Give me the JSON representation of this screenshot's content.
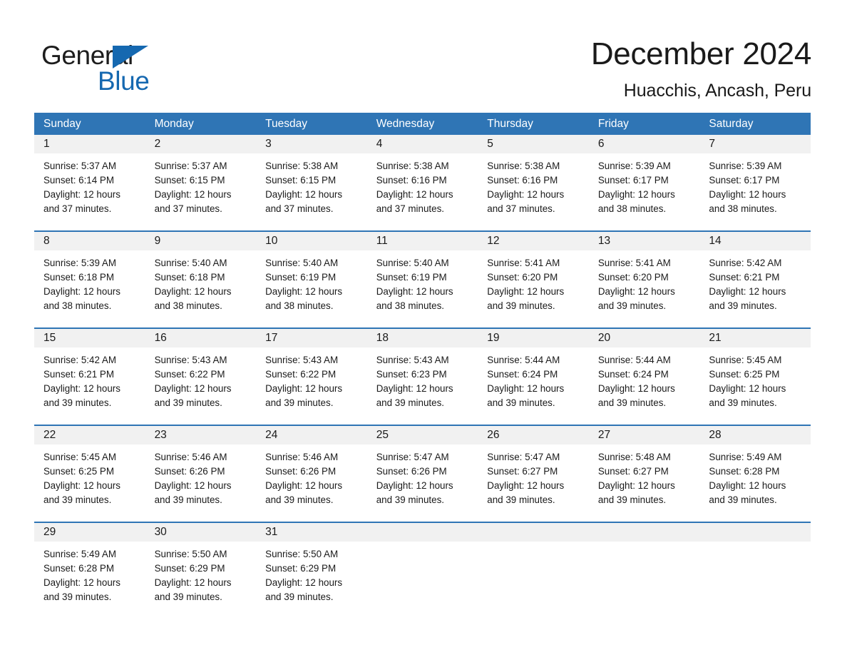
{
  "brand": {
    "word_general": "General",
    "word_blue": "Blue",
    "triangle_color": "#1568b0"
  },
  "header": {
    "month_title": "December 2024",
    "location": "Huacchis, Ancash, Peru"
  },
  "theme": {
    "header_blue": "#2f75b5",
    "daynum_band": "#f1f1f1",
    "text": "#1a1a1a"
  },
  "calendar": {
    "day_names": [
      "Sunday",
      "Monday",
      "Tuesday",
      "Wednesday",
      "Thursday",
      "Friday",
      "Saturday"
    ],
    "weeks": [
      [
        {
          "day": "1",
          "info": "Sunrise: 5:37 AM\nSunset: 6:14 PM\nDaylight: 12 hours and 37 minutes."
        },
        {
          "day": "2",
          "info": "Sunrise: 5:37 AM\nSunset: 6:15 PM\nDaylight: 12 hours and 37 minutes."
        },
        {
          "day": "3",
          "info": "Sunrise: 5:38 AM\nSunset: 6:15 PM\nDaylight: 12 hours and 37 minutes."
        },
        {
          "day": "4",
          "info": "Sunrise: 5:38 AM\nSunset: 6:16 PM\nDaylight: 12 hours and 37 minutes."
        },
        {
          "day": "5",
          "info": "Sunrise: 5:38 AM\nSunset: 6:16 PM\nDaylight: 12 hours and 37 minutes."
        },
        {
          "day": "6",
          "info": "Sunrise: 5:39 AM\nSunset: 6:17 PM\nDaylight: 12 hours and 38 minutes."
        },
        {
          "day": "7",
          "info": "Sunrise: 5:39 AM\nSunset: 6:17 PM\nDaylight: 12 hours and 38 minutes."
        }
      ],
      [
        {
          "day": "8",
          "info": "Sunrise: 5:39 AM\nSunset: 6:18 PM\nDaylight: 12 hours and 38 minutes."
        },
        {
          "day": "9",
          "info": "Sunrise: 5:40 AM\nSunset: 6:18 PM\nDaylight: 12 hours and 38 minutes."
        },
        {
          "day": "10",
          "info": "Sunrise: 5:40 AM\nSunset: 6:19 PM\nDaylight: 12 hours and 38 minutes."
        },
        {
          "day": "11",
          "info": "Sunrise: 5:40 AM\nSunset: 6:19 PM\nDaylight: 12 hours and 38 minutes."
        },
        {
          "day": "12",
          "info": "Sunrise: 5:41 AM\nSunset: 6:20 PM\nDaylight: 12 hours and 39 minutes."
        },
        {
          "day": "13",
          "info": "Sunrise: 5:41 AM\nSunset: 6:20 PM\nDaylight: 12 hours and 39 minutes."
        },
        {
          "day": "14",
          "info": "Sunrise: 5:42 AM\nSunset: 6:21 PM\nDaylight: 12 hours and 39 minutes."
        }
      ],
      [
        {
          "day": "15",
          "info": "Sunrise: 5:42 AM\nSunset: 6:21 PM\nDaylight: 12 hours and 39 minutes."
        },
        {
          "day": "16",
          "info": "Sunrise: 5:43 AM\nSunset: 6:22 PM\nDaylight: 12 hours and 39 minutes."
        },
        {
          "day": "17",
          "info": "Sunrise: 5:43 AM\nSunset: 6:22 PM\nDaylight: 12 hours and 39 minutes."
        },
        {
          "day": "18",
          "info": "Sunrise: 5:43 AM\nSunset: 6:23 PM\nDaylight: 12 hours and 39 minutes."
        },
        {
          "day": "19",
          "info": "Sunrise: 5:44 AM\nSunset: 6:24 PM\nDaylight: 12 hours and 39 minutes."
        },
        {
          "day": "20",
          "info": "Sunrise: 5:44 AM\nSunset: 6:24 PM\nDaylight: 12 hours and 39 minutes."
        },
        {
          "day": "21",
          "info": "Sunrise: 5:45 AM\nSunset: 6:25 PM\nDaylight: 12 hours and 39 minutes."
        }
      ],
      [
        {
          "day": "22",
          "info": "Sunrise: 5:45 AM\nSunset: 6:25 PM\nDaylight: 12 hours and 39 minutes."
        },
        {
          "day": "23",
          "info": "Sunrise: 5:46 AM\nSunset: 6:26 PM\nDaylight: 12 hours and 39 minutes."
        },
        {
          "day": "24",
          "info": "Sunrise: 5:46 AM\nSunset: 6:26 PM\nDaylight: 12 hours and 39 minutes."
        },
        {
          "day": "25",
          "info": "Sunrise: 5:47 AM\nSunset: 6:26 PM\nDaylight: 12 hours and 39 minutes."
        },
        {
          "day": "26",
          "info": "Sunrise: 5:47 AM\nSunset: 6:27 PM\nDaylight: 12 hours and 39 minutes."
        },
        {
          "day": "27",
          "info": "Sunrise: 5:48 AM\nSunset: 6:27 PM\nDaylight: 12 hours and 39 minutes."
        },
        {
          "day": "28",
          "info": "Sunrise: 5:49 AM\nSunset: 6:28 PM\nDaylight: 12 hours and 39 minutes."
        }
      ],
      [
        {
          "day": "29",
          "info": "Sunrise: 5:49 AM\nSunset: 6:28 PM\nDaylight: 12 hours and 39 minutes."
        },
        {
          "day": "30",
          "info": "Sunrise: 5:50 AM\nSunset: 6:29 PM\nDaylight: 12 hours and 39 minutes."
        },
        {
          "day": "31",
          "info": "Sunrise: 5:50 AM\nSunset: 6:29 PM\nDaylight: 12 hours and 39 minutes."
        },
        {
          "day": "",
          "info": ""
        },
        {
          "day": "",
          "info": ""
        },
        {
          "day": "",
          "info": ""
        },
        {
          "day": "",
          "info": ""
        }
      ]
    ]
  }
}
